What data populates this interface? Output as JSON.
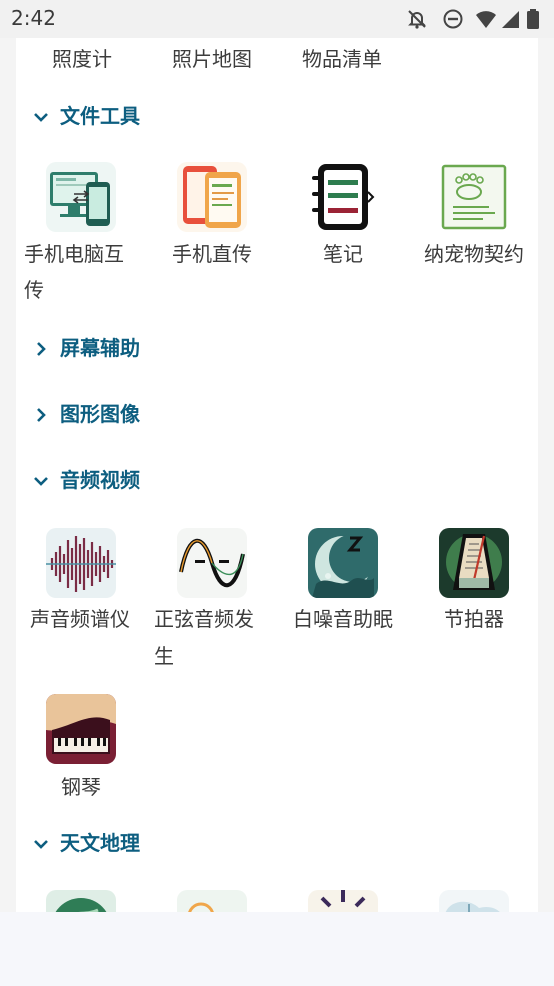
{
  "status_bar": {
    "time": "2:42"
  },
  "top_row": {
    "items": [
      "照度计",
      "照片地图",
      "物品清单"
    ]
  },
  "sections": {
    "file_tools": {
      "title": "文件工具",
      "items": [
        "手机电脑互",
        "传",
        "手机直传",
        "笔记",
        "纳宠物契约"
      ]
    },
    "screen_assist": {
      "title": "屏幕辅助"
    },
    "graphics": {
      "title": "图形图像"
    },
    "audio_video": {
      "title": "音频视频",
      "items": [
        "声音频谱仪",
        "正弦音频发",
        "生",
        "白噪音助眠",
        "节拍器",
        "钢琴"
      ]
    },
    "astronomy": {
      "title": "天文地理"
    }
  },
  "colors": {
    "accent": "#0d5e80",
    "text": "#3c3c3c"
  },
  "icons": {
    "status": [
      "notifications-off-icon",
      "do-not-disturb-icon",
      "wifi-icon",
      "cell-signal-icon",
      "battery-icon"
    ]
  }
}
